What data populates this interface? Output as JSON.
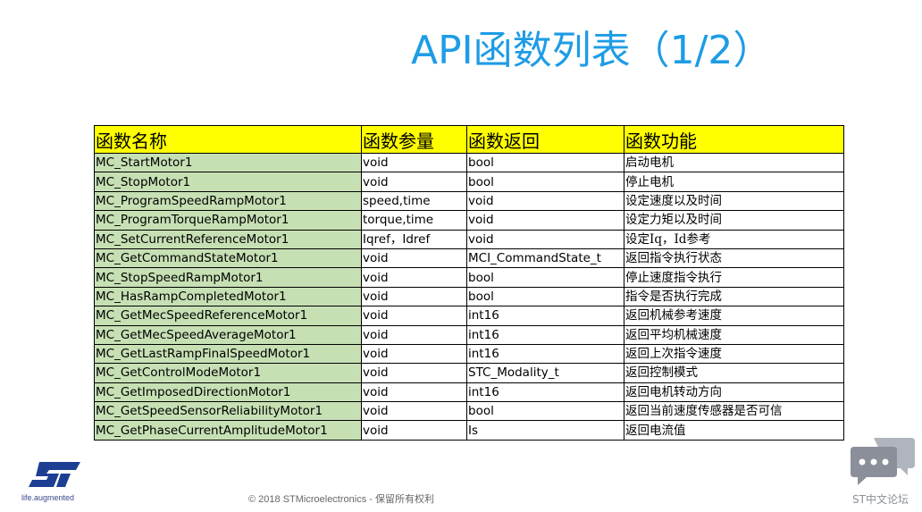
{
  "slide": {
    "title": "API函数列表（1/2）",
    "copyright": "© 2018 STMicroelectronics - 保留所有权利",
    "logo_tagline": "life.augmented",
    "forum_label": "ST中文论坛",
    "colors": {
      "title": "#1e9ce5",
      "header_bg": "#ffff00",
      "function_col_bg": "#c6e0b4"
    }
  },
  "table": {
    "headers": [
      "函数名称",
      "函数参量",
      "函数返回",
      "函数功能"
    ],
    "rows": [
      [
        "MC_StartMotor1",
        "void",
        "bool",
        "启动电机"
      ],
      [
        "MC_StopMotor1",
        "void",
        "bool",
        "停止电机"
      ],
      [
        "MC_ProgramSpeedRampMotor1",
        "speed,time",
        "void",
        "设定速度以及时间"
      ],
      [
        "MC_ProgramTorqueRampMotor1",
        "torque,time",
        "void",
        "设定力矩以及时间"
      ],
      [
        "MC_SetCurrentReferenceMotor1",
        "Iqref，Idref",
        "void",
        "设定Iq，Id参考"
      ],
      [
        "MC_GetCommandStateMotor1",
        "void",
        "MCI_CommandState_t",
        "返回指令执行状态"
      ],
      [
        "MC_StopSpeedRampMotor1",
        "void",
        "bool",
        "停止速度指令执行"
      ],
      [
        "MC_HasRampCompletedMotor1",
        "void",
        "bool",
        "指令是否执行完成"
      ],
      [
        "MC_GetMecSpeedReferenceMotor1",
        "void",
        "int16",
        "返回机械参考速度"
      ],
      [
        "MC_GetMecSpeedAverageMotor1",
        "void",
        "int16",
        "返回平均机械速度"
      ],
      [
        "MC_GetLastRampFinalSpeedMotor1",
        "void",
        "int16",
        "返回上次指令速度"
      ],
      [
        "MC_GetControlModeMotor1",
        "void",
        "STC_Modality_t",
        "返回控制模式"
      ],
      [
        "MC_GetImposedDirectionMotor1",
        "void",
        "int16",
        "返回电机转动方向"
      ],
      [
        "MC_GetSpeedSensorReliabilityMotor1",
        "void",
        "bool",
        "返回当前速度传感器是否可信"
      ],
      [
        "MC_GetPhaseCurrentAmplitudeMotor1",
        "void",
        "Is",
        "返回电流值"
      ]
    ]
  }
}
